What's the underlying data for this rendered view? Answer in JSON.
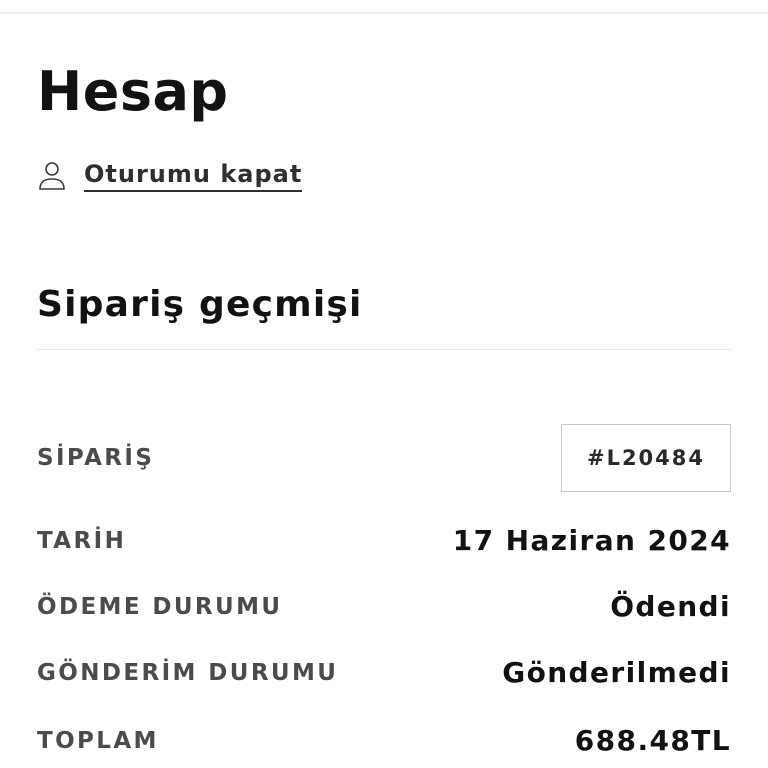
{
  "account": {
    "title": "Hesap",
    "logout_label": "Oturumu kapat"
  },
  "order_history": {
    "title": "Sipariş geçmişi",
    "rows": [
      {
        "label": "SİPARİŞ",
        "value": "#L20484"
      },
      {
        "label": "TARİH",
        "value": "17 Haziran 2024"
      },
      {
        "label": "ÖDEME DURUMU",
        "value": "Ödendi"
      },
      {
        "label": "GÖNDERİM DURUMU",
        "value": "Gönderilmedi"
      },
      {
        "label": "TOPLAM",
        "value": "688.48TL"
      }
    ]
  },
  "icons": {
    "logout": "user-icon"
  }
}
